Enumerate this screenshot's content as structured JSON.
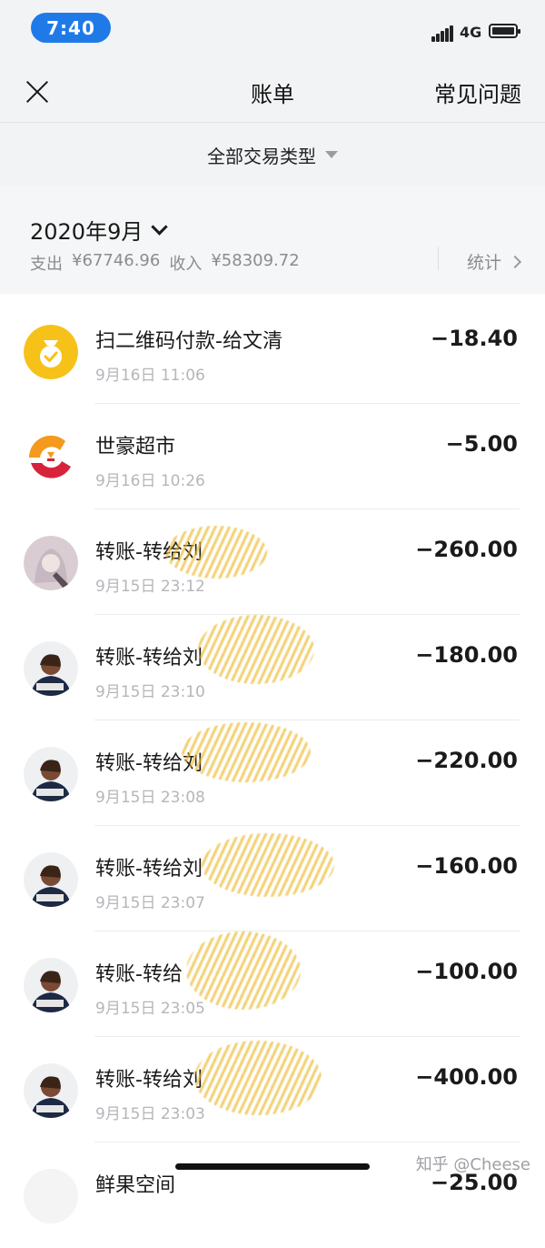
{
  "status_bar": {
    "time": "7:40",
    "network": "4G"
  },
  "nav": {
    "title": "账单",
    "right_link": "常见问题"
  },
  "filter": {
    "label": "全部交易类型"
  },
  "month": {
    "label": "2020年9月",
    "expense_label": "支出",
    "expense_value": "¥67746.96",
    "income_label": "收入",
    "income_value": "¥58309.72",
    "stats_label": "统计"
  },
  "transactions": [
    {
      "name": "扫二维码付款-给文清",
      "time": "9月16日 11:06",
      "amount": "−18.40",
      "icon": "money-bag-icon"
    },
    {
      "name": "世豪超市",
      "time": "9月16日 10:26",
      "amount": "−5.00",
      "icon": "merchant-logo-icon"
    },
    {
      "name": "转账-转给刘",
      "time": "9月15日 23:12",
      "amount": "−260.00",
      "icon": "user-avatar"
    },
    {
      "name": "转账-转给刘",
      "time": "9月15日 23:10",
      "amount": "−180.00",
      "icon": "user-avatar"
    },
    {
      "name": "转账-转给刘",
      "time": "9月15日 23:08",
      "amount": "−220.00",
      "icon": "user-avatar"
    },
    {
      "name": "转账-转给刘",
      "time": "9月15日 23:07",
      "amount": "−160.00",
      "icon": "user-avatar"
    },
    {
      "name": "转账-转给",
      "time": "9月15日 23:05",
      "amount": "−100.00",
      "icon": "user-avatar"
    },
    {
      "name": "转账-转给刘",
      "time": "9月15日 23:03",
      "amount": "−400.00",
      "icon": "user-avatar"
    },
    {
      "name": "鲜果空间",
      "time": "",
      "amount": "−25.00",
      "icon": "user-avatar"
    }
  ],
  "watermark": "知乎 @Cheese",
  "colors": {
    "accent_blue": "#1f7ae8",
    "gold_icon": "#f6c21a",
    "scribble": "#ecb726"
  }
}
